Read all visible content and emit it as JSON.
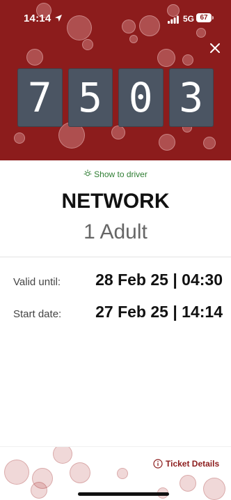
{
  "status_bar": {
    "time": "14:14",
    "network": "5G",
    "battery": "67"
  },
  "colors": {
    "brand_red": "#8c1c1c",
    "digit_box": "#4b5563",
    "show_driver_green": "#2e7d32"
  },
  "icons": {
    "close": "close-icon",
    "location": "location-arrow-icon",
    "signal": "signal-bars-icon",
    "show_driver": "sun-icon",
    "ticket_details": "info-circle-icon"
  },
  "ticket": {
    "code_digits": [
      "7",
      "5",
      "0",
      "3"
    ],
    "show_driver_label": "Show to driver",
    "type": "NETWORK",
    "passengers": "1 Adult",
    "valid_until_label": "Valid until:",
    "valid_until_value": "28 Feb 25 | 04:30",
    "start_date_label": "Start date:",
    "start_date_value": "27 Feb 25 | 14:14"
  },
  "footer": {
    "ticket_details_label": "Ticket Details"
  }
}
